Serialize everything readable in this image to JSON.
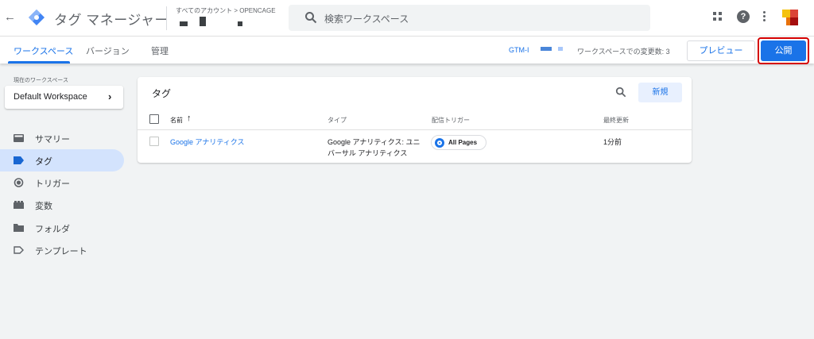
{
  "header": {
    "app_title": "タグ マネージャー",
    "account_path": "すべてのアカウント > OPENCAGE",
    "search_placeholder": "検索ワークスペース",
    "help_glyph": "?",
    "colors": {
      "logo_blue": "#4285f4",
      "logo_dark": "#1967d2"
    }
  },
  "nav": {
    "tabs": [
      {
        "label": "ワークスペース",
        "active": true
      },
      {
        "label": "バージョン",
        "active": false
      },
      {
        "label": "管理",
        "active": false
      }
    ],
    "container_id": "GTM-I",
    "changes_label": "ワークスペースでの変更数: 3",
    "preview_label": "プレビュー",
    "publish_label": "公開",
    "accent": "#1a73e8",
    "highlight": "#d40000"
  },
  "sidebar": {
    "workspace_label": "現在のワークスペース",
    "workspace_name": "Default Workspace",
    "items": [
      {
        "label": "サマリー",
        "icon": "summary-icon",
        "active": false
      },
      {
        "label": "タグ",
        "icon": "tag-icon",
        "active": true
      },
      {
        "label": "トリガー",
        "icon": "trigger-icon",
        "active": false
      },
      {
        "label": "変数",
        "icon": "variable-icon",
        "active": false
      },
      {
        "label": "フォルダ",
        "icon": "folder-icon",
        "active": false
      },
      {
        "label": "テンプレート",
        "icon": "template-icon",
        "active": false
      }
    ]
  },
  "tags_card": {
    "title": "タグ",
    "new_label": "新規",
    "columns": [
      "名前",
      "タイプ",
      "配信トリガー",
      "最終更新"
    ],
    "rows": [
      {
        "name": "Google アナリティクス",
        "type_line1": "Google アナリティクス: ユニ",
        "type_line2": "バーサル アナリティクス",
        "trigger": "All Pages",
        "updated": "1分前"
      }
    ]
  }
}
